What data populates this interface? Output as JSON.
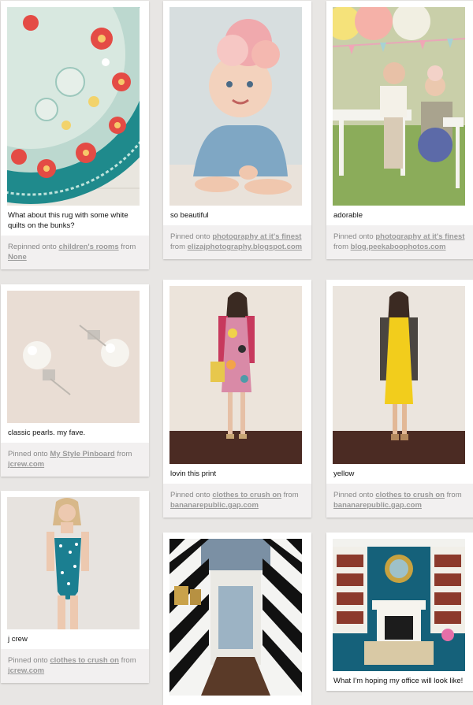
{
  "pins": [
    {
      "caption": "What about this rug with some white quilts on the bunks?",
      "prefix": "Repinned onto",
      "board": "children's rooms",
      "from_word": "from",
      "source": "None"
    },
    {
      "caption": "so beautiful",
      "prefix": "Pinned onto",
      "board": "photography at it's finest",
      "from_word": "from",
      "source": "elizajphotography.blogspot.com"
    },
    {
      "caption": "adorable",
      "prefix": "Pinned onto",
      "board": "photography at it's finest",
      "from_word": "from",
      "source": "blog.peekaboophotos.com"
    },
    {
      "caption": "classic pearls. my fave.",
      "prefix": "Pinned onto",
      "board": "My Style Pinboard",
      "from_word": "from",
      "source": "jcrew.com"
    },
    {
      "caption": "lovin this print",
      "prefix": "Pinned onto",
      "board": "clothes to crush on",
      "from_word": "from",
      "source": "bananarepublic.gap.com"
    },
    {
      "caption": "yellow",
      "prefix": "Pinned onto",
      "board": "clothes to crush on",
      "from_word": "from",
      "source": "bananarepublic.gap.com"
    },
    {
      "caption": "j crew",
      "prefix": "Pinned onto",
      "board": "clothes to crush on",
      "from_word": "from",
      "source": "jcrew.com"
    },
    {
      "caption": ""
    },
    {
      "caption": "What I'm hoping my office will look like!"
    }
  ]
}
